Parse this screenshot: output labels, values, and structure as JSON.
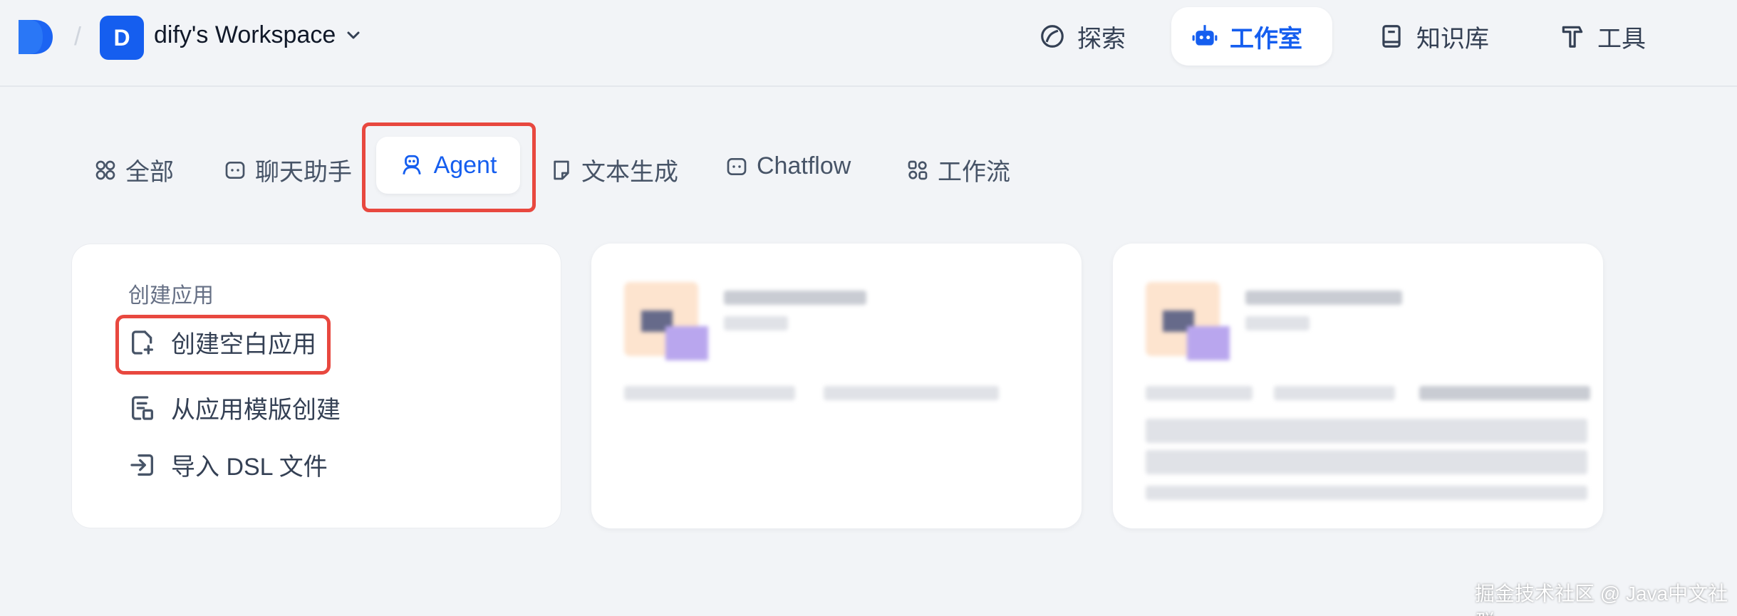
{
  "header": {
    "workspace_initial": "D",
    "workspace_name": "dify's Workspace",
    "nav": [
      {
        "label": "探索",
        "icon": "compass-icon"
      },
      {
        "label": "工作室",
        "icon": "robot-icon",
        "active": true
      },
      {
        "label": "知识库",
        "icon": "book-icon"
      },
      {
        "label": "工具",
        "icon": "hammer-icon"
      }
    ]
  },
  "tabs": [
    {
      "label": "全部",
      "icon": "grid-icon"
    },
    {
      "label": "聊天助手",
      "icon": "chat-bot-icon"
    },
    {
      "label": "Agent",
      "icon": "agent-icon",
      "active": true
    },
    {
      "label": "文本生成",
      "icon": "note-icon"
    },
    {
      "label": "Chatflow",
      "icon": "chat-bot-icon"
    },
    {
      "label": "工作流",
      "icon": "workflow-icon"
    }
  ],
  "create": {
    "title": "创建应用",
    "options": [
      {
        "label": "创建空白应用",
        "icon": "file-plus-icon",
        "highlighted": true
      },
      {
        "label": "从应用模版创建",
        "icon": "file-list-icon"
      },
      {
        "label": "导入 DSL 文件",
        "icon": "import-icon"
      }
    ]
  },
  "watermark": "掘金技术社区 @ Java中文社群",
  "colors": {
    "accent": "#155eef",
    "highlight_border": "#e8483f",
    "background": "#f2f4f7"
  }
}
